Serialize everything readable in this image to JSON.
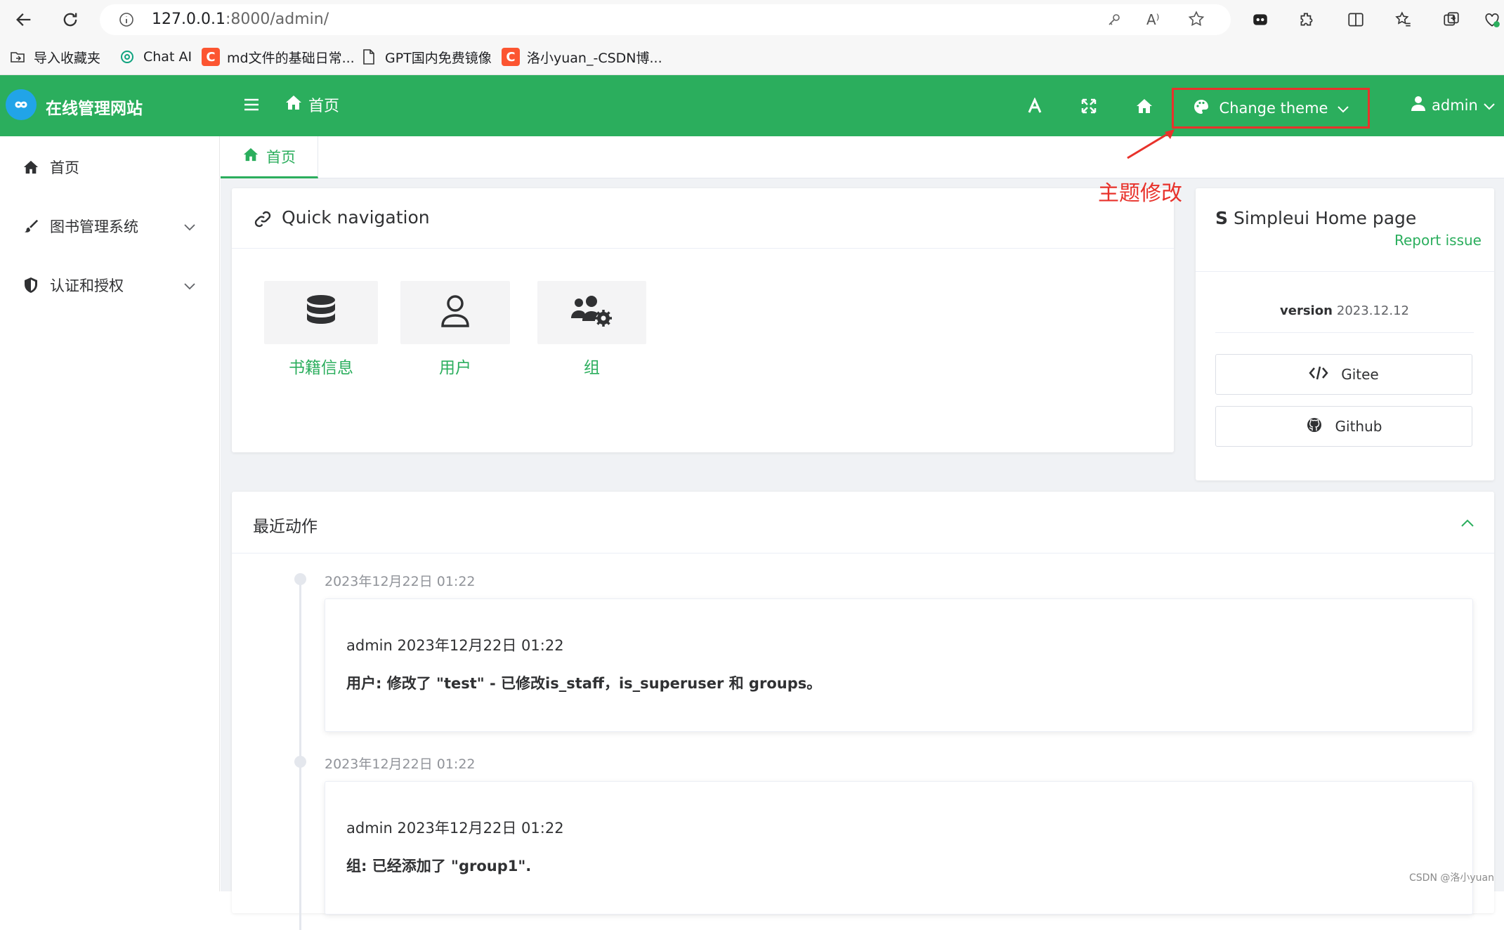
{
  "browser": {
    "url_host": "127.0.0.1",
    "url_rest": ":8000/admin/",
    "bookmarks": [
      {
        "label": "导入收藏夹",
        "icon": "import-favorites-icon"
      },
      {
        "label": "Chat AI",
        "icon": "openai-icon"
      },
      {
        "label": "md文件的基础日常...",
        "icon": "csdn-icon",
        "badge": "C"
      },
      {
        "label": "GPT国内免费镜像",
        "icon": "page-icon"
      },
      {
        "label": "洛小yuan_-CSDN博...",
        "icon": "csdn-icon",
        "badge": "C"
      }
    ]
  },
  "header": {
    "site_title": "在线管理网站",
    "breadcrumb": "首页",
    "theme_label": "Change theme",
    "user_label": "admin",
    "bg_color": "#2bae5d"
  },
  "sidebar": {
    "items": [
      {
        "label": "首页",
        "icon": "home-icon"
      },
      {
        "label": "图书管理系统",
        "icon": "brush-icon"
      },
      {
        "label": "认证和授权",
        "icon": "shield-icon"
      }
    ]
  },
  "tabs": {
    "home": "首页"
  },
  "quicknav": {
    "title": "Quick navigation",
    "items": [
      {
        "label": "书籍信息",
        "icon": "database-icon"
      },
      {
        "label": "用户",
        "icon": "user-icon"
      },
      {
        "label": "组",
        "icon": "users-cog-icon"
      }
    ]
  },
  "simpleui": {
    "logo": "S",
    "title": "Simpleui Home page",
    "report": "Report issue",
    "version_label": "version",
    "version_value": "2023.12.12",
    "gitee": "Gitee",
    "github": "Github"
  },
  "recent": {
    "title": "最近动作",
    "entries": [
      {
        "time": "2023年12月22日 01:22",
        "user": "admin 2023年12月22日 01:22",
        "message": "用户: 修改了 \"test\" - 已修改is_staff，is_superuser 和 groups。"
      },
      {
        "time": "2023年12月22日 01:22",
        "user": "admin 2023年12月22日 01:22",
        "message": "组: 已经添加了 \"group1\"."
      }
    ]
  },
  "annotation": {
    "text": "主题修改",
    "color": "#e8322b"
  },
  "watermark": "CSDN @洛小yuan"
}
